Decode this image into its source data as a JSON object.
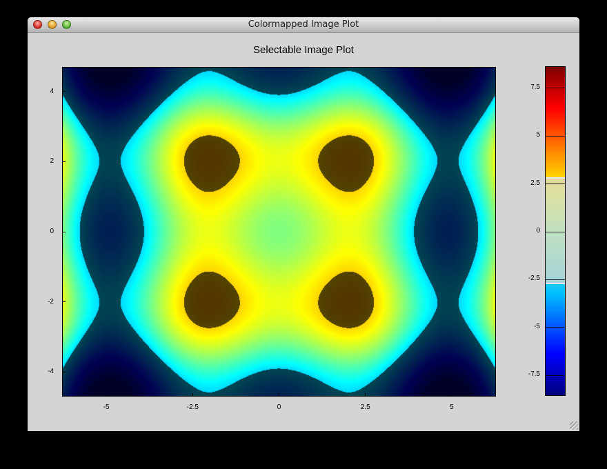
{
  "window": {
    "title": "Colormapped Image Plot"
  },
  "traffic_lights": [
    "close",
    "minimize",
    "zoom"
  ],
  "chart_data": [
    {
      "type": "heatmap",
      "title": "Selectable Image Plot",
      "function": "z = x * sin(x) + y * sin(y)",
      "xlim": [
        -6.28,
        6.28
      ],
      "ylim": [
        -4.7,
        4.7
      ],
      "x_ticks": [
        "-5",
        "-2.5",
        "0",
        "2.5",
        "5"
      ],
      "x_tick_values": [
        -5,
        -2.5,
        0,
        2.5,
        5
      ],
      "y_ticks": [
        "4",
        "2",
        "0",
        "-2",
        "-4"
      ],
      "y_tick_values": [
        4,
        2,
        0,
        -2,
        -4
      ],
      "colormap": "jet",
      "color_range": [
        -8.6,
        8.6
      ],
      "selection_range": [
        -2.75,
        2.85
      ],
      "selection_effect": "values outside the selected range are dimmed"
    },
    {
      "type": "colorbar",
      "ticks": [
        "7.5",
        "5",
        "2.5",
        "0",
        "-2.5",
        "-5",
        "-7.5"
      ],
      "tick_values": [
        7.5,
        5,
        2.5,
        0,
        -2.5,
        -5,
        -7.5
      ],
      "range": [
        -8.6,
        8.6
      ],
      "selected_range": [
        -2.75,
        2.85
      ]
    }
  ]
}
